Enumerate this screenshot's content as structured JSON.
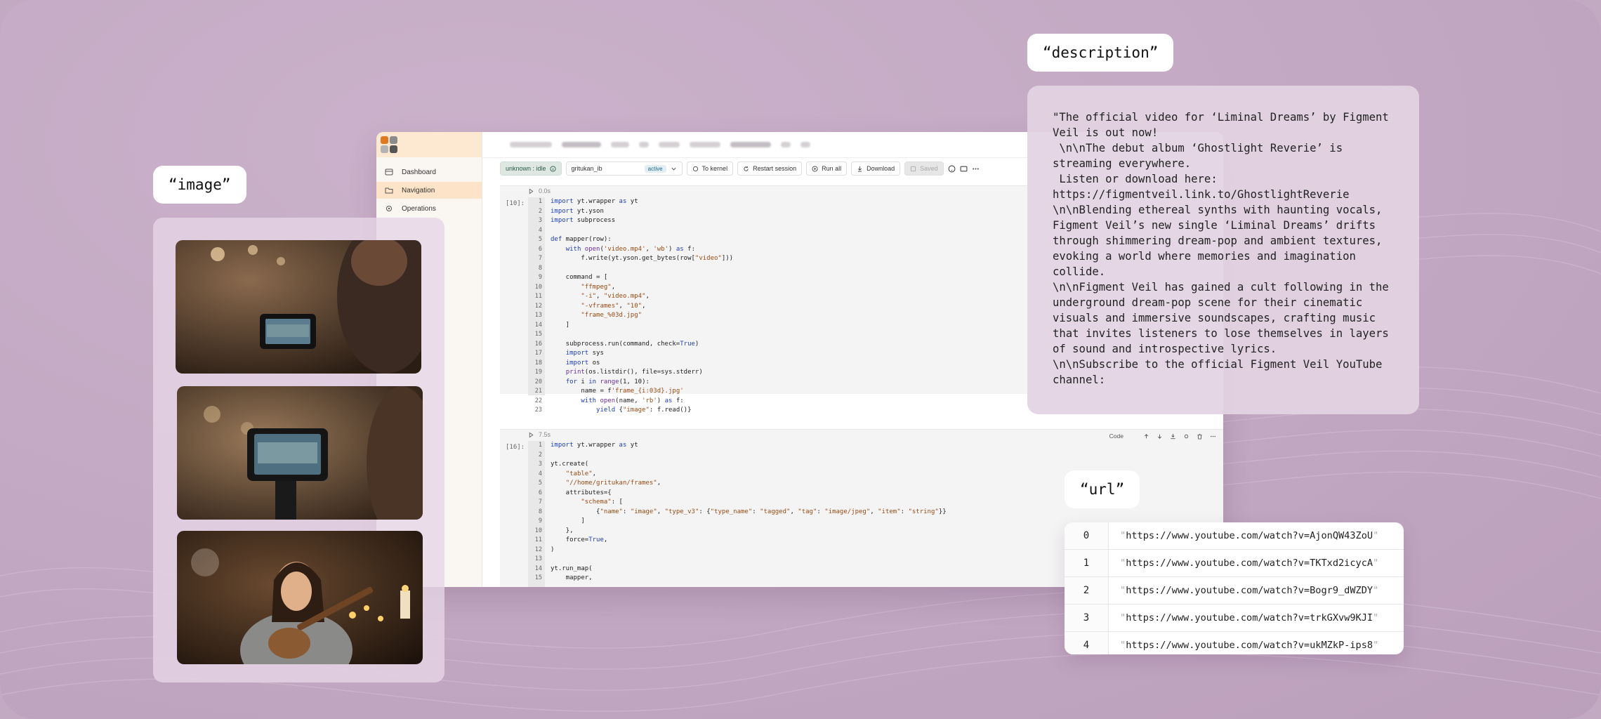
{
  "labels": {
    "image": "“image”",
    "description": "“description”",
    "url": "“url”"
  },
  "sidebar": {
    "items": [
      {
        "label": "Dashboard",
        "icon": "dashboard-icon"
      },
      {
        "label": "Navigation",
        "icon": "folder-icon",
        "active": true
      },
      {
        "label": "Operations",
        "icon": "gear-icon"
      }
    ]
  },
  "toolbar": {
    "kernel_status": "unknown : idle",
    "kernel_name": "gritukan_ib",
    "kernel_badge": "active",
    "to_kernel": "To kernel",
    "restart": "Restart session",
    "run_all": "Run all",
    "download": "Download",
    "saved": "Saved"
  },
  "cells": [
    {
      "prompt": "[10]:",
      "duration": "0.0s",
      "lines": [
        "import yt.wrapper as yt",
        "import yt.yson",
        "import subprocess",
        "",
        "def mapper(row):",
        "    with open('video.mp4', 'wb') as f:",
        "        f.write(yt.yson.get_bytes(row[\"video\"]))",
        "",
        "    command = [",
        "        \"ffmpeg\",",
        "        \"-i\", \"video.mp4\",",
        "        \"-vframes\", \"10\",",
        "        \"frame_%03d.jpg\"",
        "    ]",
        "",
        "    subprocess.run(command, check=True)",
        "    import sys",
        "    import os",
        "    print(os.listdir(), file=sys.stderr)",
        "    for i in range(1, 10):",
        "        name = f'frame_{i:03d}.jpg'",
        "        with open(name, 'rb') as f:",
        "            yield {\"image\": f.read()}"
      ]
    },
    {
      "prompt": "[16]:",
      "duration": "7.5s",
      "cell_type": "Code",
      "lines": [
        "import yt.wrapper as yt",
        "",
        "yt.create(",
        "    \"table\",",
        "    \"//home/gritukan/frames\",",
        "    attributes={",
        "        \"schema\": [",
        "            {\"name\": \"image\", \"type_v3\": {\"type_name\": \"tagged\", \"tag\": \"image/jpeg\", \"item\": \"string\"}}",
        "        ]",
        "    },",
        "    force=True,",
        ")",
        "",
        "yt.run_map(",
        "    mapper,"
      ]
    }
  ],
  "description": "\"The official video for ‘Liminal Dreams’ by Figment Veil is out now!\n \\n\\nThe debut album ‘Ghostlight Reverie’ is streaming everywhere.\n Listen or download here: https://figmentveil.link.to/GhostlightReverie\n\\n\\nBlending ethereal synths with haunting vocals, Figment Veil’s new single ‘Liminal Dreams’ drifts through shimmering dream-pop and ambient textures, evoking a world where memories and imagination collide.\n\\n\\nFigment Veil has gained a cult following in the underground dream-pop scene for their cinematic visuals and immersive soundscapes, crafting music that invites listeners to lose themselves in layers of sound and introspective lyrics.\n\\n\\nSubscribe to the official Figment Veil YouTube channel:",
  "urls": [
    {
      "index": "0",
      "value": "https://www.youtube.com/watch?v=AjonQW43ZoU"
    },
    {
      "index": "1",
      "value": "https://www.youtube.com/watch?v=TKTxd2icycA"
    },
    {
      "index": "2",
      "value": "https://www.youtube.com/watch?v=Bogr9_dWZDY"
    },
    {
      "index": "3",
      "value": "https://www.youtube.com/watch?v=trkGXvw9KJI"
    },
    {
      "index": "4",
      "value": "https://www.youtube.com/watch?v=ukMZkP-ips8"
    }
  ],
  "images": [
    {
      "icon": "video-shoot-photo"
    },
    {
      "icon": "camera-monitor-photo"
    },
    {
      "icon": "ukulele-singer-photo"
    }
  ]
}
